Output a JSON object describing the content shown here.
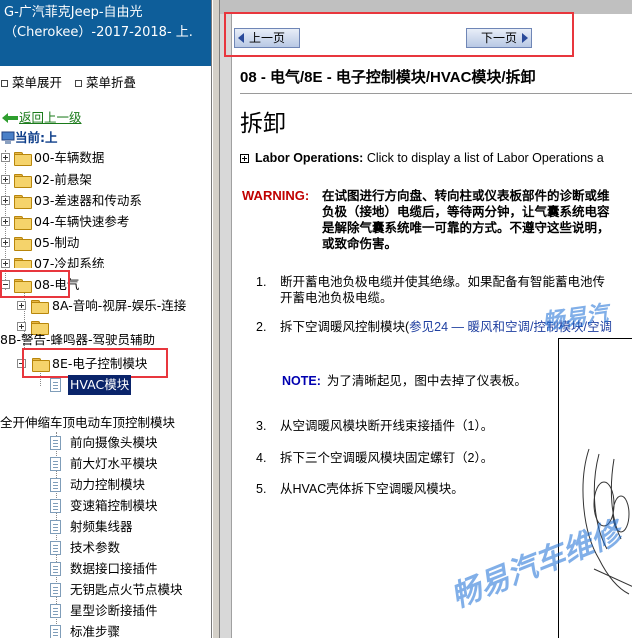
{
  "left_panel": {
    "header_line1": "G-广汽菲克Jeep-自由光",
    "header_line2": "（Cherokee）-2017-2018- 上.",
    "expand_all": "菜单展开",
    "collapse_all": "菜单折叠",
    "back": "返回上一级",
    "current": "当前:上",
    "tree": {
      "item_00": "00-车辆数据",
      "item_02": "02-前悬架",
      "item_03": "03-差速器和传动系",
      "item_04": "04-车辆快速参考",
      "item_05": "05-制动",
      "item_07": "07-冷却系统",
      "item_08": "08-电气",
      "item_8a": "8A-音响-视屏-娱乐-连接",
      "item_8b": "8B-警告-蜂鸣器-驾驶员辅助",
      "item_8e": "8E-电子控制模块",
      "item_hvac": "HVAC模块",
      "item_roof": "全开伸缩车顶电动车顶控制模块",
      "children": [
        "前向摄像头模块",
        "前大灯水平模块",
        "动力控制模块",
        "变速箱控制模块",
        "射频集线器",
        "技术参数",
        "数据接口接插件",
        "无钥匙点火节点模块",
        "星型诊断接插件",
        "标准步骤"
      ]
    }
  },
  "right_panel": {
    "prev_page": "上一页",
    "next_page": "下一页",
    "content_title": "08 - 电气/8E - 电子控制模块/HVAC模块/拆卸",
    "section_title": "拆卸",
    "labor_bold": "Labor Operations:",
    "labor_text": " Click to display a list of Labor Operations a",
    "warning_label": "WARNING:",
    "warning_lines": [
      "在试图进行方向盘、转向柱或仪表板部件的诊断或维",
      "负极（接地）电缆后，等待两分钟，让气囊系统电容",
      "是解除气囊系统唯一可靠的方式。不遵守这些说明，",
      "或致命伤害。"
    ],
    "steps": [
      {
        "num": "1.",
        "lines": [
          "断开蓄电池负极电缆并使其绝缘。如果配备有智能蓄电池传",
          "开蓄电池负极电缆。"
        ]
      },
      {
        "num": "2.",
        "pre": "拆下空调暖风控制模块(",
        "link": "参见24 — 暖风和空调/控制模块/空调",
        "post": ""
      },
      {
        "num": "3.",
        "lines": [
          "从空调暖风模块断开线束接插件（1）。"
        ]
      },
      {
        "num": "4.",
        "lines": [
          "拆下三个空调暖风模块固定螺钉（2）。"
        ]
      },
      {
        "num": "5.",
        "lines": [
          "从HVAC壳体拆下空调暖风模块。"
        ]
      }
    ],
    "note_label": "NOTE:",
    "note_text": "为了清晰起见，图中去掉了仪表板。",
    "watermark_1": "畅易汽",
    "watermark_2": "畅易汽车维修"
  }
}
